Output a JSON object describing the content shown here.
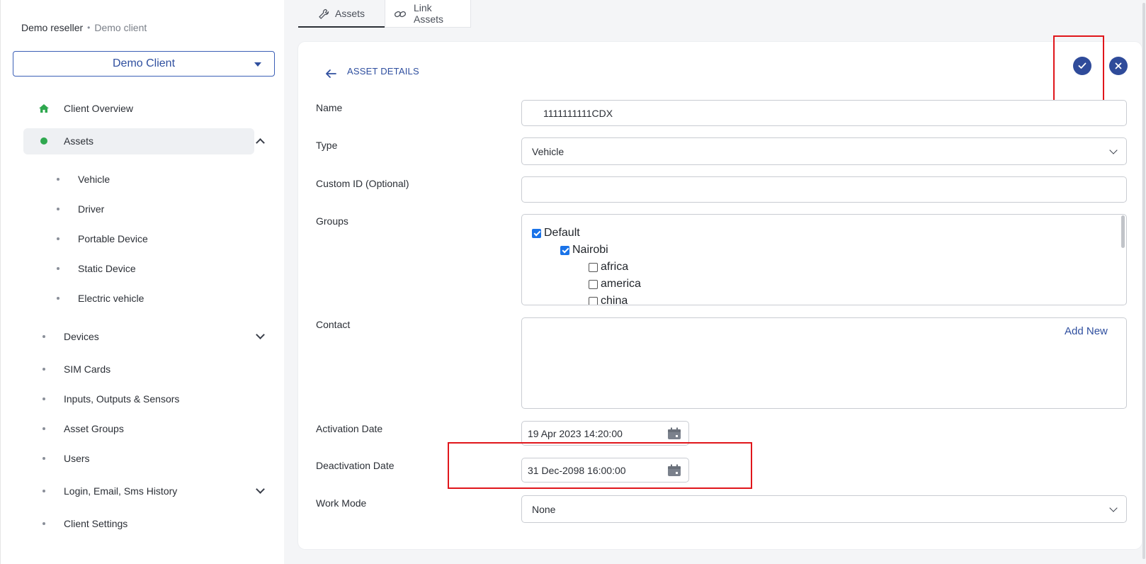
{
  "breadcrumb": {
    "reseller": "Demo reseller",
    "separator": "•",
    "client": "Demo client"
  },
  "client_selector": {
    "value": "Demo Client"
  },
  "sidebar": {
    "items": [
      {
        "label": "Client Overview",
        "icon": "home-icon"
      },
      {
        "label": "Assets",
        "active": true
      },
      {
        "label": "Vehicle"
      },
      {
        "label": "Driver"
      },
      {
        "label": "Portable Device"
      },
      {
        "label": "Static Device"
      },
      {
        "label": "Electric vehicle"
      },
      {
        "label": "Devices"
      },
      {
        "label": "SIM Cards"
      },
      {
        "label": "Inputs, Outputs & Sensors"
      },
      {
        "label": "Asset Groups"
      },
      {
        "label": "Users"
      },
      {
        "label": "Login, Email, Sms History"
      },
      {
        "label": "Client Settings"
      }
    ]
  },
  "tabs": [
    {
      "label": "Assets",
      "icon": "wrench-icon",
      "active": true
    },
    {
      "label": "Link Assets",
      "icon": "link-icon"
    }
  ],
  "card": {
    "title": "ASSET DETAILS"
  },
  "form": {
    "name": {
      "label": "Name",
      "value": "1111111111CDX"
    },
    "type": {
      "label": "Type",
      "value": "Vehicle"
    },
    "custom_id": {
      "label": "Custom ID (Optional)",
      "value": ""
    },
    "groups": {
      "label": "Groups",
      "tree": [
        {
          "label": "Default",
          "checked": true,
          "level": 0
        },
        {
          "label": "Nairobi",
          "checked": true,
          "level": 1
        },
        {
          "label": "africa",
          "checked": false,
          "level": 2
        },
        {
          "label": "america",
          "checked": false,
          "level": 2
        },
        {
          "label": "china",
          "checked": false,
          "level": 2
        }
      ]
    },
    "contact": {
      "label": "Contact",
      "add_new": "Add New"
    },
    "activation_date": {
      "label": "Activation Date",
      "value": "19 Apr 2023 14:20:00"
    },
    "deactivation_date": {
      "label": "Deactivation Date",
      "value": "31 Dec-2098 16:00:00"
    },
    "work_mode": {
      "label": "Work Mode",
      "value": "None"
    }
  },
  "colors": {
    "accent": "#2f4b9a",
    "highlight": "#e0161b",
    "active_dot": "#2fa84f"
  }
}
